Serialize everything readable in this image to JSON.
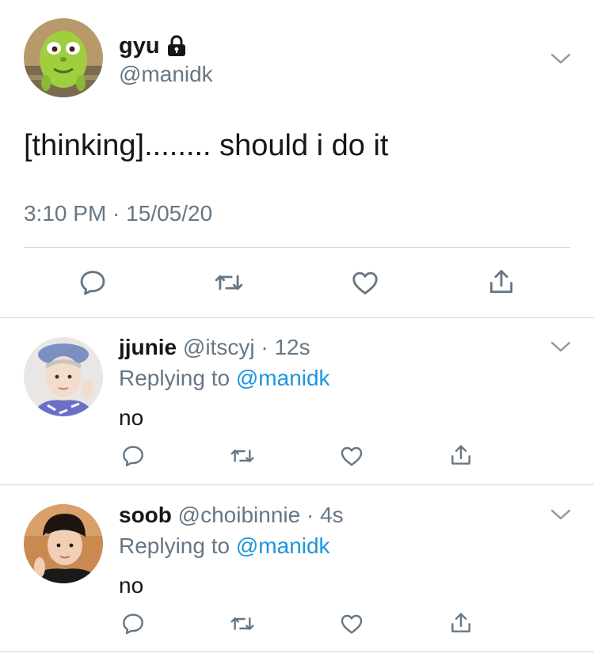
{
  "colors": {
    "text": "#14171a",
    "secondary": "#657786",
    "link": "#1b95e0",
    "divider": "#cfd6dc"
  },
  "main_tweet": {
    "display_name": "gyu",
    "handle": "@manidk",
    "text": "[thinking]........ should i do it",
    "timestamp": "3:10 PM · 15/05/20",
    "actions": [
      "reply-icon",
      "retweet-icon",
      "like-icon",
      "share-icon"
    ]
  },
  "replies": [
    {
      "display_name": "jjunie",
      "handle": "@itscyj",
      "time": "· 12s",
      "replying_prefix": "Replying to",
      "replying_to": "@manidk",
      "text": "no"
    },
    {
      "display_name": "soob",
      "handle": "@choibinnie",
      "time": "· 4s",
      "replying_prefix": "Replying to",
      "replying_to": "@manidk",
      "text": "no"
    }
  ]
}
